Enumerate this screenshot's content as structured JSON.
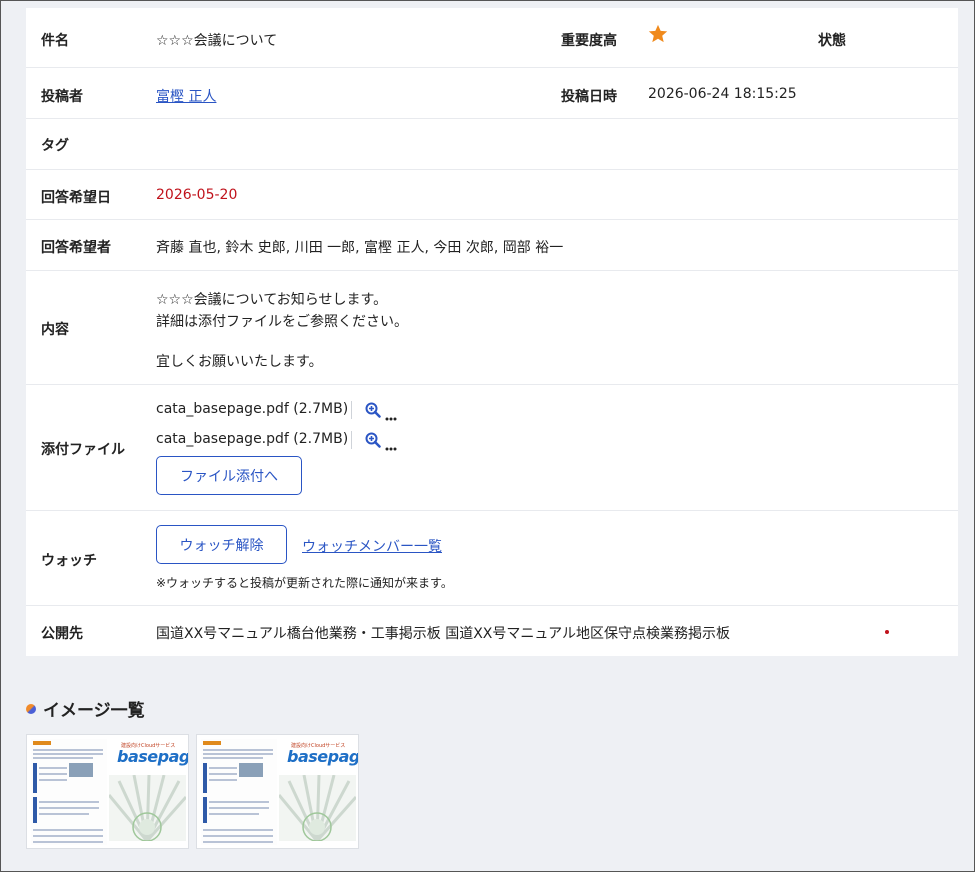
{
  "fields": {
    "subject_label": "件名",
    "subject_value": "☆☆☆会議について",
    "priority_label": "重要度高",
    "status_label": "状態",
    "poster_label": "投稿者",
    "poster_value": "富樫 正人",
    "posted_at_label": "投稿日時",
    "posted_at_value": "2026-06-24 18:15:25",
    "tags_label": "タグ",
    "due_label": "回答希望日",
    "due_value": "2026-05-20",
    "respondents_label": "回答希望者",
    "respondents_value": "斉藤 直也, 鈴木 史郎, 川田 一郎, 富樫 正人, 今田 次郎, 岡部 裕一",
    "content_label": "内容",
    "content_lines": [
      "☆☆☆会議についてお知らせします。",
      "詳細は添付ファイルをご参照ください。",
      "宜しくお願いいたします。"
    ],
    "attach_label": "添付ファイル",
    "attachments": [
      "cata_basepage.pdf (2.7MB)",
      "cata_basepage.pdf (2.7MB)"
    ],
    "attach_button": "ファイル添付へ",
    "watch_label": "ウォッチ",
    "unwatch_button": "ウォッチ解除",
    "watch_members_link": "ウォッチメンバー一覧",
    "watch_note": "※ウォッチすると投稿が更新された際に通知が来ます。",
    "publish_label": "公開先",
    "publish_value": "国道XX号マニュアル橋台他業務・工事掲示板 国道XX号マニュアル地区保守点検業務掲示板"
  },
  "images_section": {
    "title": "イメージ一覧",
    "brand_text": "basepage",
    "brand_sub": "建設向けCloudサービス"
  },
  "colors": {
    "accent": "#2a55c4",
    "star": "#f08a1c",
    "due_red": "#c0121b"
  }
}
